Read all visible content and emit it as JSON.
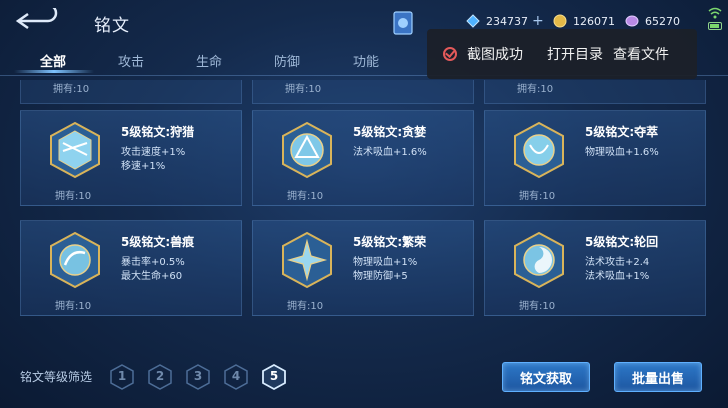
{
  "header": {
    "title": "铭文"
  },
  "currencies": [
    {
      "icon": "diamond-icon",
      "value": "234737",
      "has_plus": true,
      "color": "#4fb2ff"
    },
    {
      "icon": "gold-coin-icon",
      "value": "126071",
      "has_plus": false,
      "color": "#e3b948"
    },
    {
      "icon": "crystal-icon",
      "value": "65270",
      "has_plus": false,
      "color": "#b98ae6"
    }
  ],
  "tabs": [
    {
      "label": "全部",
      "active": true
    },
    {
      "label": "攻击",
      "active": false
    },
    {
      "label": "生命",
      "active": false
    },
    {
      "label": "防御",
      "active": false
    },
    {
      "label": "功能",
      "active": false
    }
  ],
  "toast": {
    "message": "截图成功",
    "action_open_dir": "打开目录",
    "action_view_file": "查看文件"
  },
  "partial_row": {
    "owned": [
      "拥有:10",
      "拥有:10",
      "拥有:10"
    ]
  },
  "inscriptions": [
    {
      "name": "5级铭文:狩猎",
      "attrs": [
        "攻击速度+1%",
        "移速+1%"
      ],
      "owned": "拥有:10",
      "icon": "hunting-inscription-icon"
    },
    {
      "name": "5级铭文:贪婪",
      "attrs": [
        "法术吸血+1.6%"
      ],
      "owned": "拥有:10",
      "icon": "greed-inscription-icon"
    },
    {
      "name": "5级铭文:夺萃",
      "attrs": [
        "物理吸血+1.6%"
      ],
      "owned": "拥有:10",
      "icon": "plunder-inscription-icon"
    },
    {
      "name": "5级铭文:兽痕",
      "attrs": [
        "暴击率+0.5%",
        "最大生命+60"
      ],
      "owned": "拥有:10",
      "icon": "beast-mark-inscription-icon"
    },
    {
      "name": "5级铭文:繁荣",
      "attrs": [
        "物理吸血+1%",
        "物理防御+5"
      ],
      "owned": "拥有:10",
      "icon": "prosperity-inscription-icon"
    },
    {
      "name": "5级铭文:轮回",
      "attrs": [
        "法术攻击+2.4",
        "法术吸血+1%"
      ],
      "owned": "拥有:10",
      "icon": "reincarnation-inscription-icon"
    }
  ],
  "bottom": {
    "filter_label": "铭文等级筛选",
    "levels": [
      "1",
      "2",
      "3",
      "4",
      "5"
    ],
    "active_level": "5",
    "btn_obtain": "铭文获取",
    "btn_sell": "批量出售"
  }
}
